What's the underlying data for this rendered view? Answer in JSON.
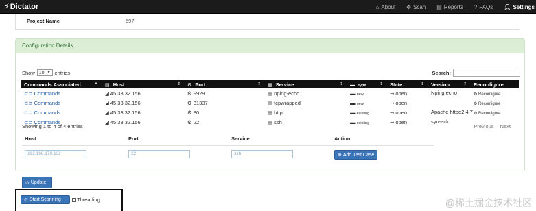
{
  "navbar": {
    "brand": "Dictator",
    "links": [
      {
        "label": "About",
        "icon": "home-icon"
      },
      {
        "label": "Scan",
        "icon": "move-icon"
      },
      {
        "label": "Reports",
        "icon": "reports-icon"
      },
      {
        "label": "FAQs",
        "icon": "question-icon"
      },
      {
        "label": "Settings",
        "icon": "user-icon"
      }
    ]
  },
  "project": {
    "label": "Project Name",
    "value": "597"
  },
  "panel": {
    "title": "Configuration Details"
  },
  "table_controls": {
    "show": "Show",
    "entries_value": "10",
    "entries": "entries",
    "search_label": "Search:",
    "info": "Showing 1 to 4 of 4 entries",
    "prev": "Previous",
    "next": "Next"
  },
  "table": {
    "headers": {
      "commands": "Commands Associated",
      "host": "Host",
      "port": "Port",
      "service": "Service",
      "type": "type",
      "state": "State",
      "version": "Version",
      "reconfigure": "Reconfigure"
    },
    "rows": [
      {
        "cmd": "Commands",
        "host": "45.33.32.156",
        "port": "9929",
        "service": "nping-echo",
        "type": "new",
        "state": "open",
        "version": "Nping echo",
        "reconf": "Reconfigure"
      },
      {
        "cmd": "Commands",
        "host": "45.33.32.156",
        "port": "31337",
        "service": "tcpwrapped",
        "type": "new",
        "state": "open",
        "version": "",
        "reconf": "Reconfigure"
      },
      {
        "cmd": "Commands",
        "host": "45.33.32.156",
        "port": "80",
        "service": "http",
        "type": "existing",
        "state": "open",
        "version": "Apache httpd2.4.7",
        "reconf": "Reconfigure"
      },
      {
        "cmd": "Commands",
        "host": "45.33.32.156",
        "port": "22",
        "service": "ssh",
        "type": "existing",
        "state": "open",
        "version": "syn-ack",
        "reconf": "Reconfigure"
      }
    ]
  },
  "form": {
    "headers": {
      "host": "Host",
      "port": "Port",
      "service": "Service",
      "action": "Action"
    },
    "host_value": "192.168.179.132",
    "port_value": "22",
    "service_value": "ssh",
    "add_button": "Add Test Case"
  },
  "buttons": {
    "update": "Update",
    "start_scanning": "Start Scanning",
    "threading": "Threading"
  },
  "watermark": "@稀土掘金技术社区",
  "colors": {
    "navbar": "#1b1b1b",
    "panel_heading": "#dcefd6",
    "primary": "#3a74b9",
    "link": "#1f5fa8"
  }
}
